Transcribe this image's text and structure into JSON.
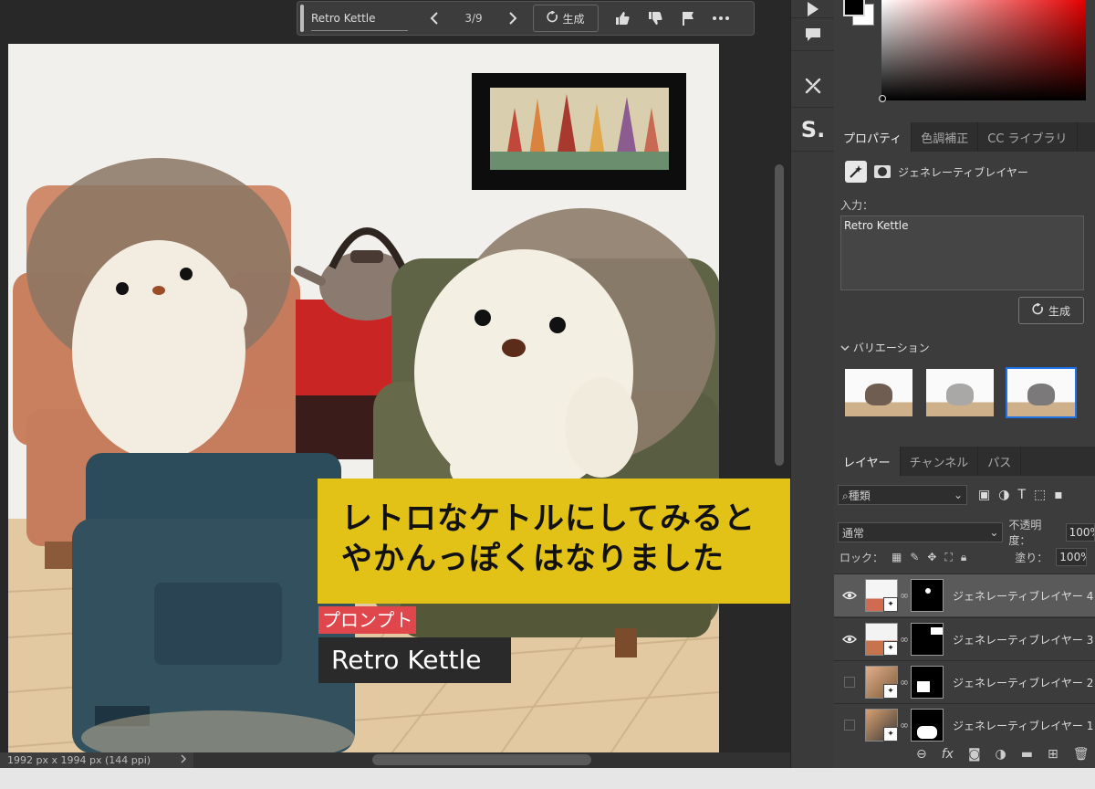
{
  "toolbar": {
    "prompt": "Retro Kettle",
    "counter": "3/9",
    "generate_label": "生成"
  },
  "status": {
    "dimensions": "1992 px x 1994 px (144 ppi)"
  },
  "overlay": {
    "caption_line1": "レトロなケトルにしてみると",
    "caption_line2": "やかんっぽくはなりました",
    "prompt_tag": "プロンプト",
    "prompt_value": "Retro Kettle"
  },
  "tool_strip": {
    "s_label": "S."
  },
  "properties": {
    "tabs": [
      "プロパティ",
      "色調補正",
      "CC ライブラリ"
    ],
    "layer_type": "ジェネレーティブレイヤー",
    "input_label": "入力：",
    "prompt_text": "Retro Kettle",
    "generate_label": "生成",
    "variations_label": "バリエーション"
  },
  "layers": {
    "tabs": [
      "レイヤー",
      "チャンネル",
      "パス"
    ],
    "filter_label": "種類",
    "blend_mode": "通常",
    "opacity_label": "不透明度：",
    "opacity_value": "100%",
    "lock_label": "ロック：",
    "fill_label": "塗り：",
    "fill_value": "100%",
    "items": [
      {
        "name": "ジェネレーティブレイヤー 4"
      },
      {
        "name": "ジェネレーティブレイヤー 3"
      },
      {
        "name": "ジェネレーティブレイヤー 2"
      },
      {
        "name": "ジェネレーティブレイヤー 1"
      }
    ]
  },
  "colors": {
    "caption_bg": "#e2c216",
    "prompt_tag_bg": "#e0474c",
    "selection_blue": "#1f73e6",
    "panel_bg": "#3c3c3c"
  },
  "icons": [
    "chevron-left-icon",
    "chevron-right-icon",
    "regenerate-icon",
    "thumbs-up-icon",
    "thumbs-down-icon",
    "flag-icon",
    "more-icon",
    "play-icon",
    "comment-icon",
    "tools-icon",
    "eye-icon",
    "link-icon"
  ]
}
